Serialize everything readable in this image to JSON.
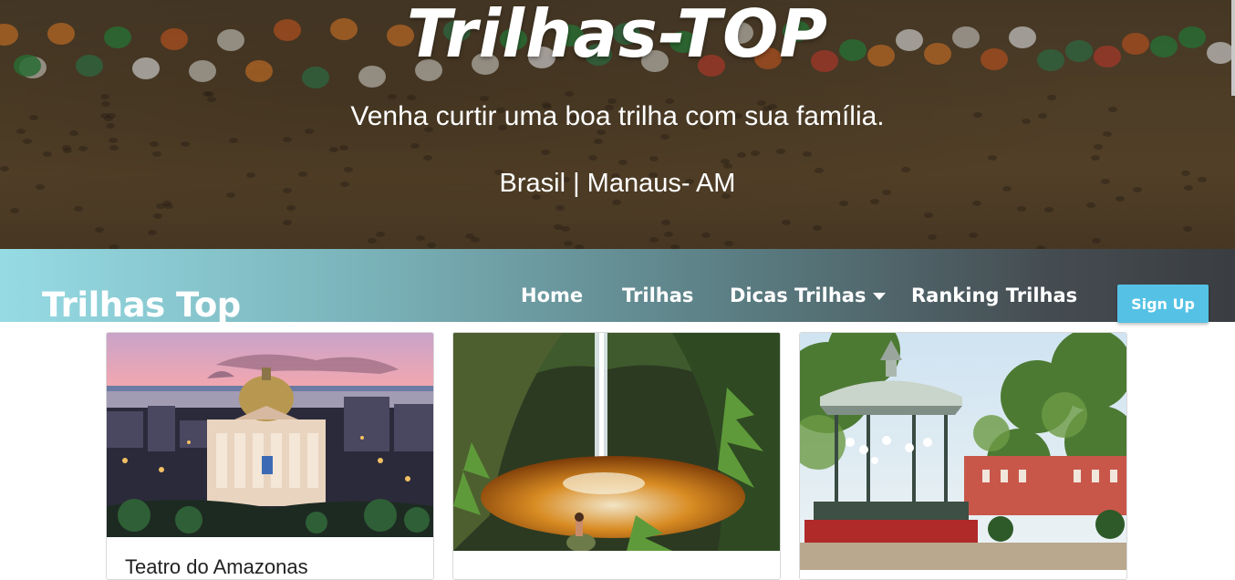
{
  "hero": {
    "title": "Trilhas-TOP",
    "subtitle": "Venha curtir uma boa trilha com sua família.",
    "location": "Brasil | Manaus- AM"
  },
  "nav": {
    "brand": "Trilhas Top",
    "links": [
      {
        "label": "Home"
      },
      {
        "label": "Trilhas"
      },
      {
        "label": "Dicas Trilhas"
      },
      {
        "label": "Ranking Trilhas"
      }
    ],
    "signup_label": "Sign Up"
  },
  "cards": [
    {
      "title": "Teatro do Amazonas"
    },
    {
      "title": ""
    },
    {
      "title": ""
    }
  ],
  "colors": {
    "accent": "#55c2e5",
    "nav_start": "#96dbe4",
    "nav_end": "#3a3d41"
  }
}
